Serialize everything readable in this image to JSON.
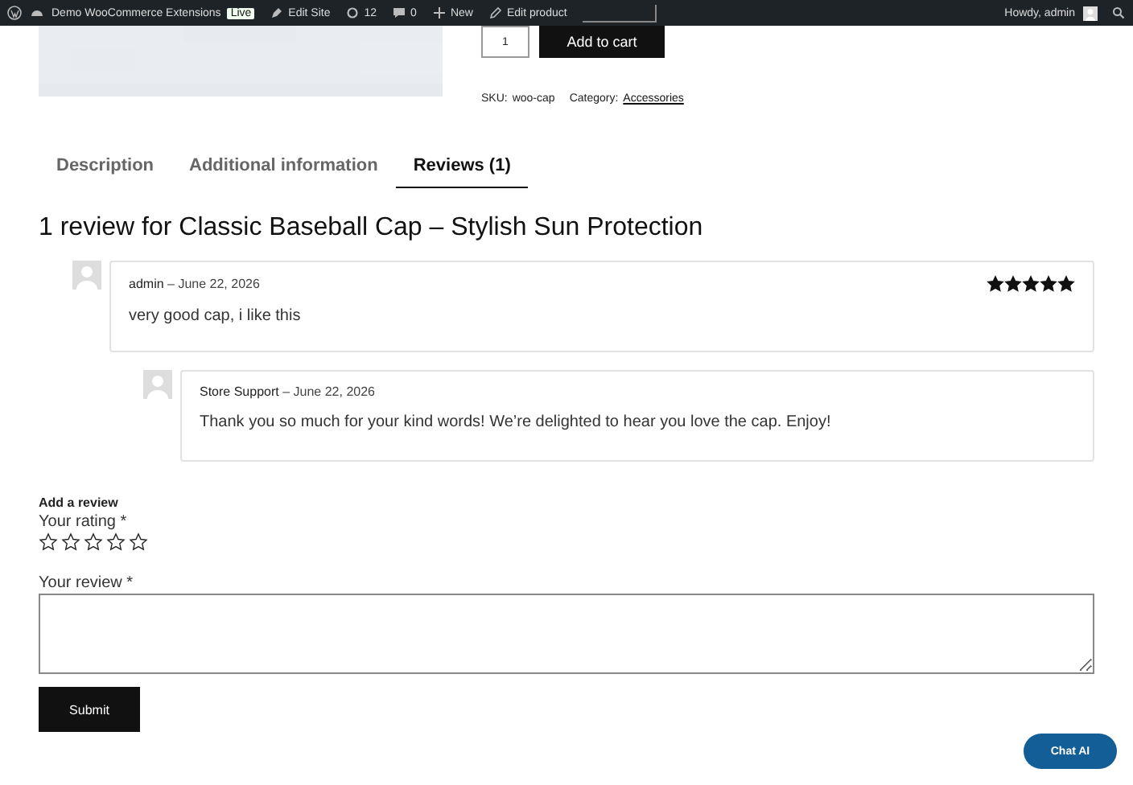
{
  "admin_bar": {
    "site": "Demo WooCommerce Extensions",
    "site_badge": "Live",
    "items": [
      {
        "kind": "edit-site",
        "label": "Edit Site"
      },
      {
        "kind": "updates",
        "label": "12"
      },
      {
        "kind": "comments",
        "label": "0"
      },
      {
        "kind": "new",
        "label": "New"
      },
      {
        "kind": "edit",
        "label": "Edit product"
      }
    ],
    "greeting": "Howdy, admin"
  },
  "product": {
    "quantity": "1",
    "add_to_cart": "Add to cart",
    "sku_label": "SKU:",
    "sku": "woo-cap",
    "category_label": "Category:",
    "category": "Accessories"
  },
  "tabs": [
    {
      "label": "Description",
      "selected": false
    },
    {
      "label": "Additional information",
      "selected": false
    },
    {
      "label": "Reviews (1)",
      "selected": true
    }
  ],
  "reviews_title": "1 review for Classic Baseball Cap – Stylish Sun Protection",
  "reviews": [
    {
      "author": "admin",
      "date": "– June 22, 2026",
      "text": "very good cap, i like this",
      "stars": 5,
      "replies": [
        {
          "author": "Store Support",
          "date": "– June 22, 2026",
          "text": "Thank you so much for your kind words! We’re delighted to hear you love the cap. Enjoy!"
        }
      ]
    }
  ],
  "form": {
    "title": "Add a review",
    "rating_label": "Your rating *",
    "stars": 0,
    "review_label": "Your review *",
    "submit": "Submit"
  },
  "chat_button": "Chat AI"
}
